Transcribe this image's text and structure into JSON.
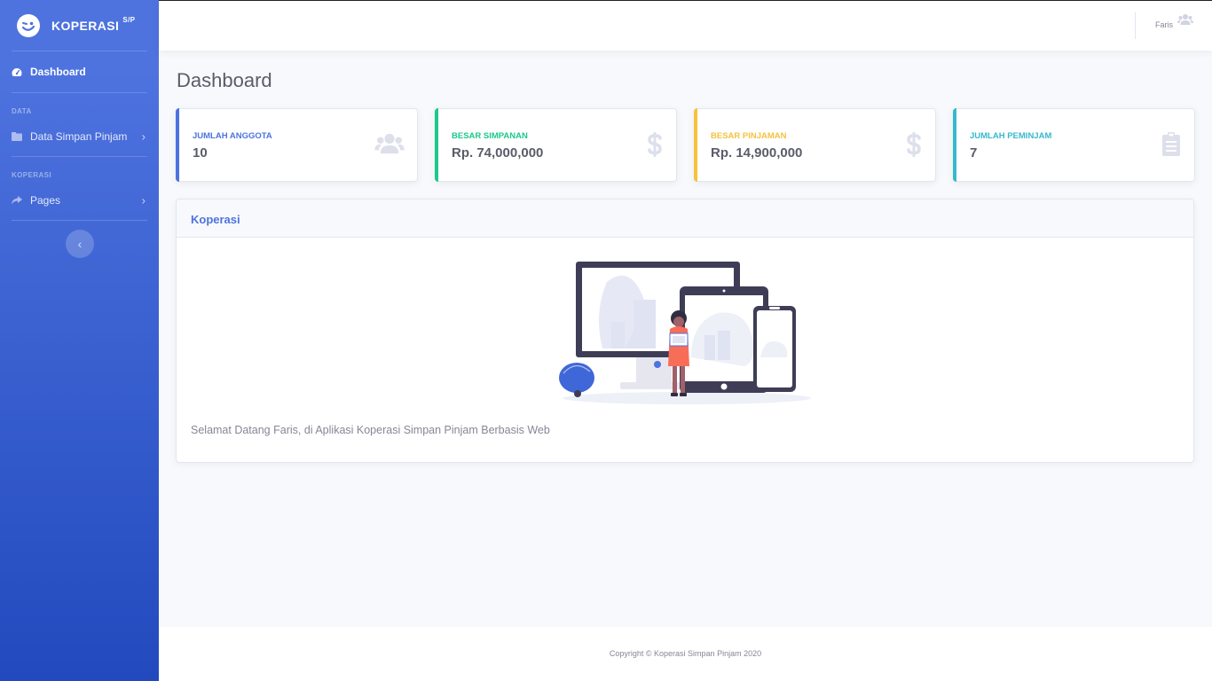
{
  "brand": {
    "name": "KOPERASI",
    "sup": "S/P"
  },
  "sidebar": {
    "items": [
      {
        "label": "Dashboard"
      },
      {
        "label": "Data Simpan Pinjam"
      },
      {
        "label": "Pages"
      }
    ],
    "headings": [
      "DATA",
      "KOPERASI"
    ]
  },
  "topbar": {
    "user_name": "Faris"
  },
  "page": {
    "title": "Dashboard"
  },
  "stats": [
    {
      "label": "JUMLAH ANGGOTA",
      "value": "10",
      "color": "#4e73df"
    },
    {
      "label": "BESAR SIMPANAN",
      "value": "Rp. 74,000,000",
      "color": "#1cc88a"
    },
    {
      "label": "BESAR PINJAMAN",
      "value": "Rp. 14,900,000",
      "color": "#f6c23e"
    },
    {
      "label": "JUMLAH PEMINJAM",
      "value": "7",
      "color": "#36b9cc"
    }
  ],
  "main_card": {
    "title": "Koperasi",
    "welcome": "Selamat Datang Faris, di Aplikasi Koperasi Simpan Pinjam Berbasis Web"
  },
  "footer": {
    "copyright": "Copyright © Koperasi Simpan Pinjam 2020"
  }
}
